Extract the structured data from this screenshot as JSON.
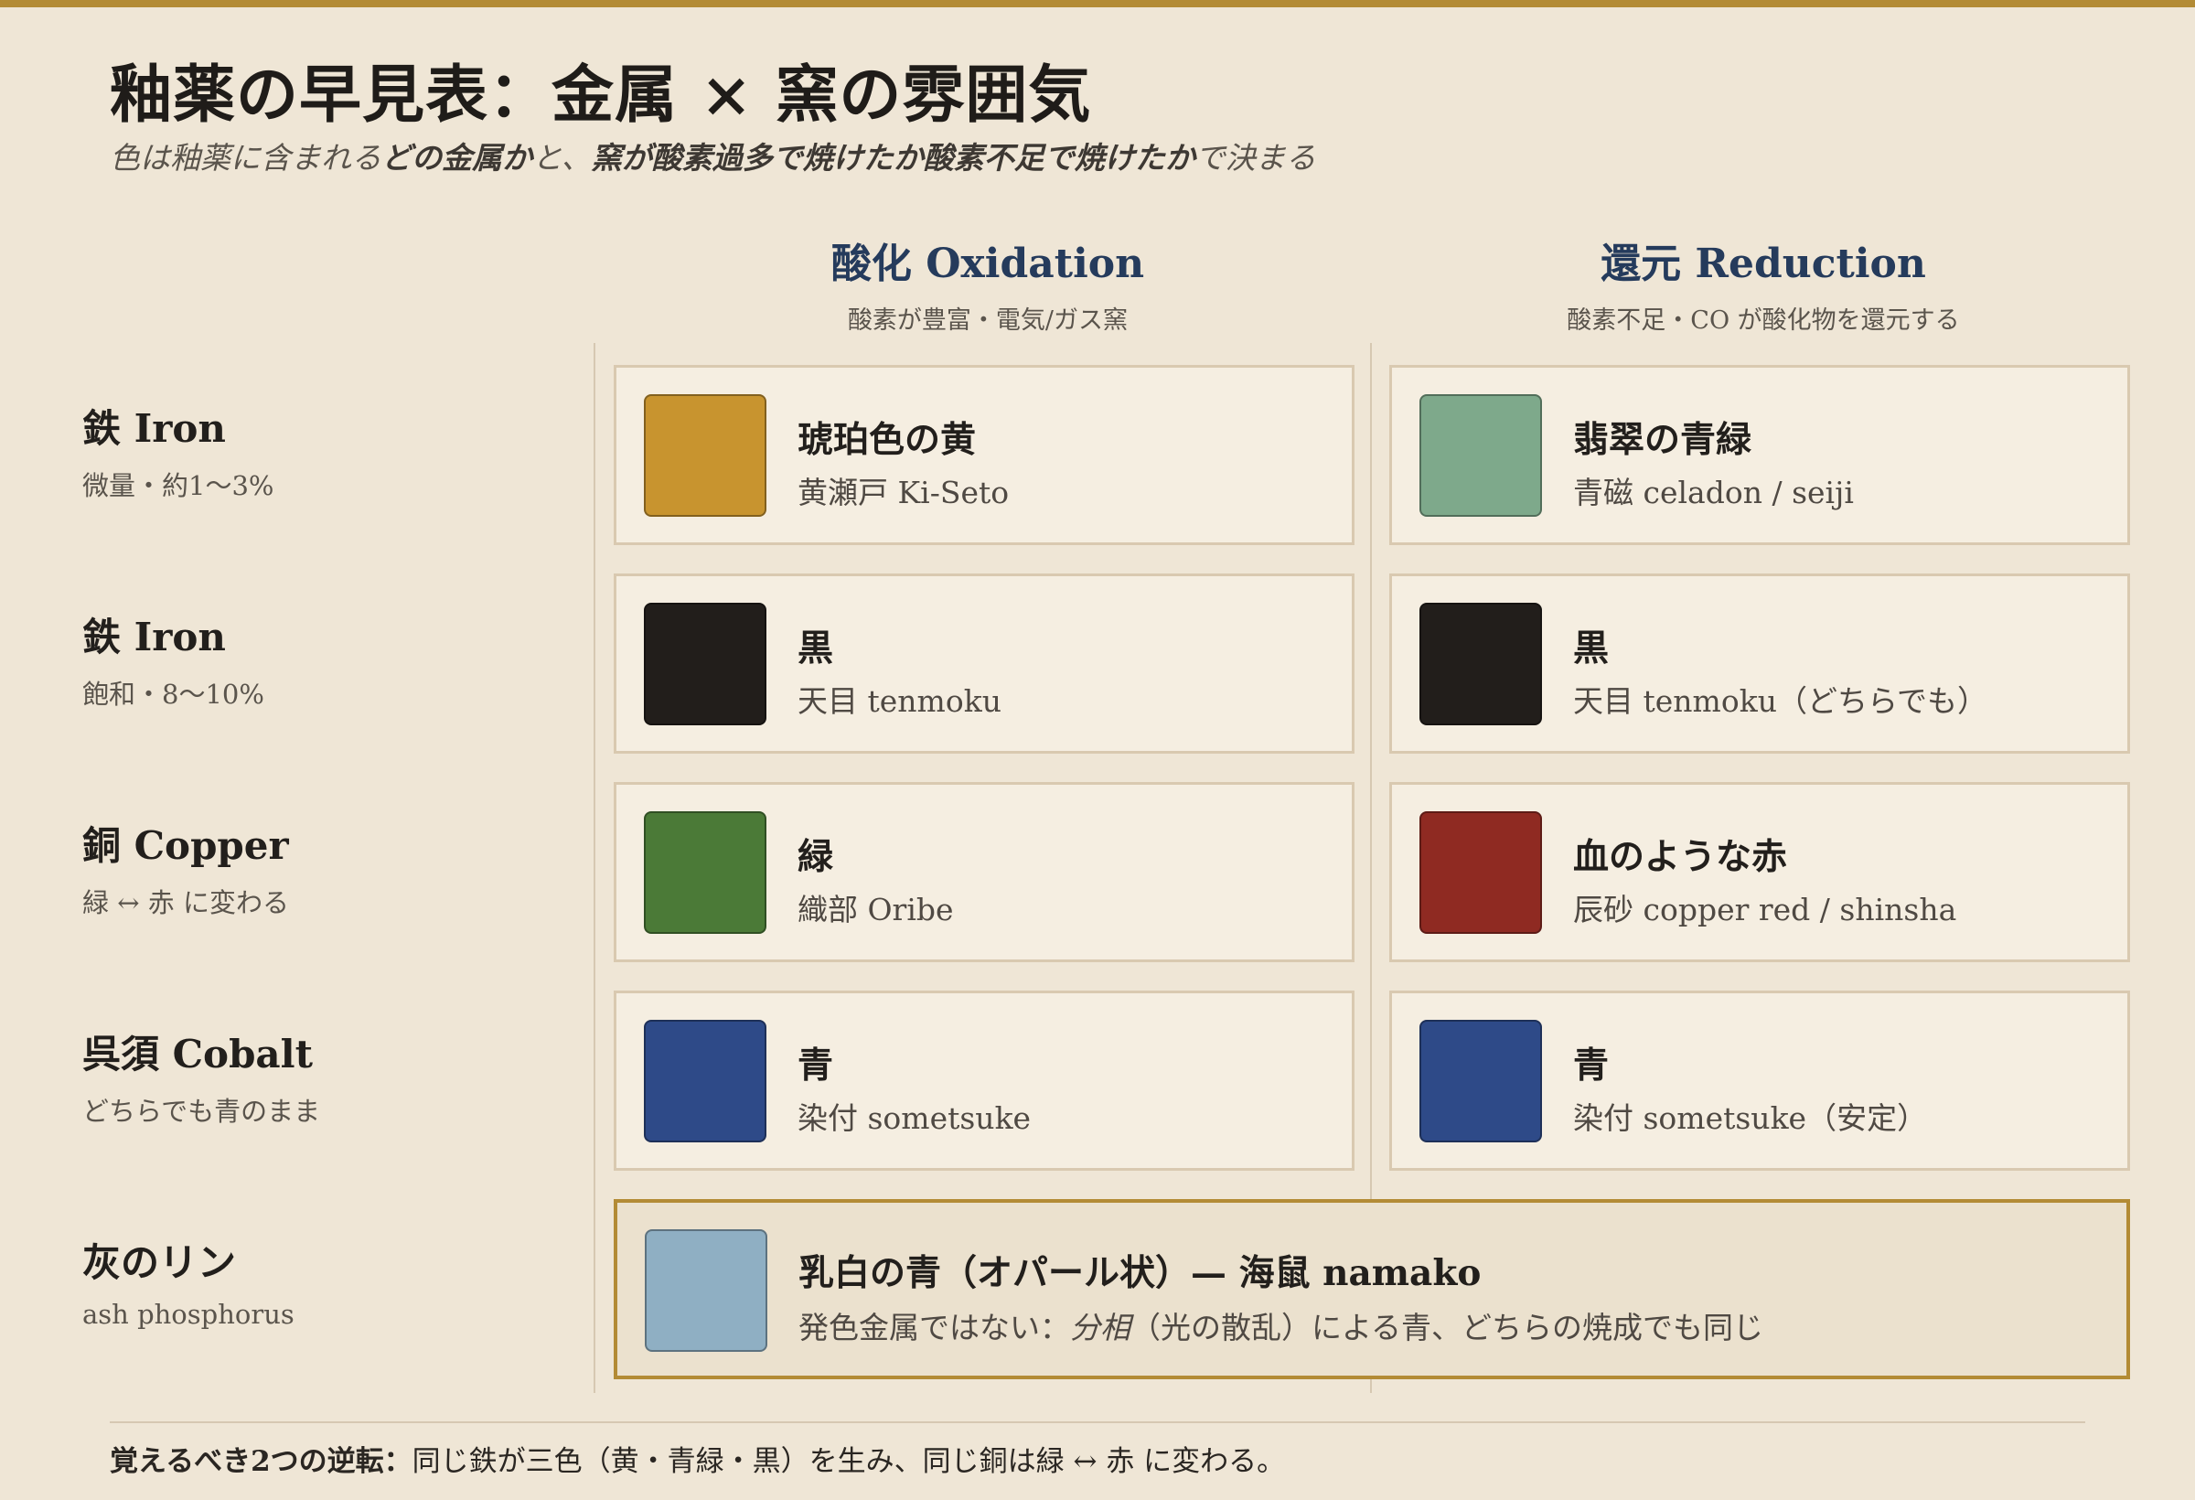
{
  "title": "釉薬の早見表：金属 × 窯の雰囲気",
  "subtitle": {
    "part1": "色は釉薬に含まれる",
    "part2": "どの金属か",
    "part3": "と、",
    "part4": "窯が酸素過多で焼けたか酸素不足で焼けたか",
    "part5": "で決まる"
  },
  "columns": [
    {
      "title": "酸化 Oxidation",
      "subtitle": "酸素が豊富・電気/ガス窯"
    },
    {
      "title": "還元 Reduction",
      "subtitle": "酸素不足・CO が酸化物を還元する"
    }
  ],
  "rows": [
    {
      "label": "鉄 Iron",
      "sublabel": "微量・約1〜3%",
      "oxidation": {
        "name": "琥珀色の黄",
        "desc": "黄瀬戸 Ki-Seto",
        "color": "#c8942f"
      },
      "reduction": {
        "name": "翡翠の青緑",
        "desc": "青磁 celadon / seiji",
        "color": "#7ea98b"
      }
    },
    {
      "label": "鉄 Iron",
      "sublabel": "飽和・8〜10%",
      "oxidation": {
        "name": "黒",
        "desc": "天目 tenmoku",
        "color": "#221e1b"
      },
      "reduction": {
        "name": "黒",
        "desc": "天目 tenmoku（どちらでも）",
        "color": "#221e1b"
      }
    },
    {
      "label": "銅 Copper",
      "sublabel": "緑 ↔ 赤 に変わる",
      "oxidation": {
        "name": "緑",
        "desc": "織部 Oribe",
        "color": "#4b7a37"
      },
      "reduction": {
        "name": "血のような赤",
        "desc": "辰砂 copper red / shinsha",
        "color": "#8f2a22"
      }
    },
    {
      "label": "呉須 Cobalt",
      "sublabel": "どちらでも青のまま",
      "oxidation": {
        "name": "青",
        "desc": "染付 sometsuke",
        "color": "#2e4a88"
      },
      "reduction": {
        "name": "青",
        "desc": "染付 sometsuke（安定）",
        "color": "#2e4a88"
      }
    }
  ],
  "ash_row": {
    "label": "灰のリン",
    "sublabel": "ash phosphorus",
    "name": "乳白の青（オパール状）— 海鼠 namako",
    "desc_part1": "発色金属ではない：",
    "desc_part2": "分相",
    "desc_part3": "（光の散乱）による青、どちらの焼成でも同じ",
    "color": "#8fafc3"
  },
  "footnote": {
    "bold": "覚えるべき2つの逆転：",
    "text": "同じ鉄が三色（黄・青緑・黒）を生み、同じ銅は緑 ↔ 赤 に変わる。"
  }
}
